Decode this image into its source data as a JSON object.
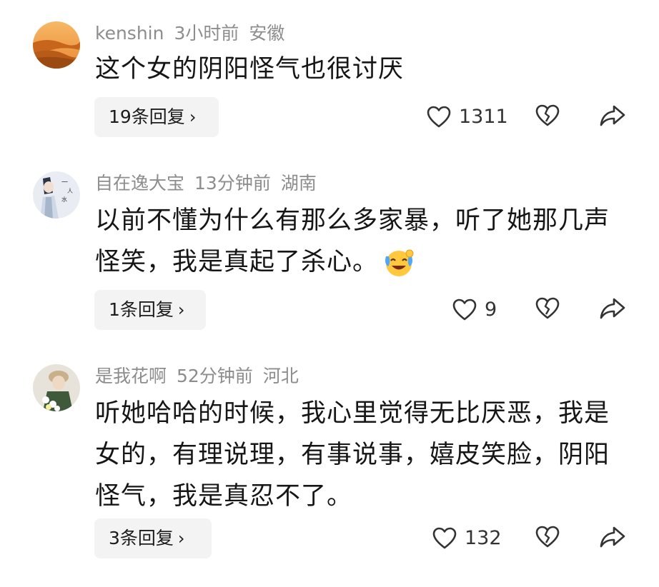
{
  "comments": [
    {
      "username": "kenshin",
      "time": "3小时前",
      "location": "安徽",
      "text": "这个女的阴阳怪气也很讨厌",
      "replies_label": "19条回复",
      "likes": "1311"
    },
    {
      "username": "自在逸大宝",
      "time": "13分钟前",
      "location": "湖南",
      "text": "以前不懂为什么有那么多家暴，听了她那几声怪笑，我是真起了杀心。",
      "replies_label": "1条回复",
      "likes": "9"
    },
    {
      "username": "是我花啊",
      "time": "52分钟前",
      "location": "河北",
      "text": "听她哈哈的时候，我心里觉得无比厌恶，我是女的，有理说理，有事说事，嬉皮笑脸，阴阳怪气，我是真忍不了。",
      "replies_label": "3条回复",
      "likes": "132"
    }
  ],
  "icons": {
    "like": "heart-outline-icon",
    "dislike": "broken-heart-icon",
    "share": "share-arrow-icon",
    "emoji": "laugh-cry-emoji"
  },
  "colors": {
    "meta_text": "#8d8d8d",
    "reply_bg": "#f3f3f3",
    "emoji_yellow": "#ffc83d",
    "emoji_blue": "#4da6ff"
  }
}
